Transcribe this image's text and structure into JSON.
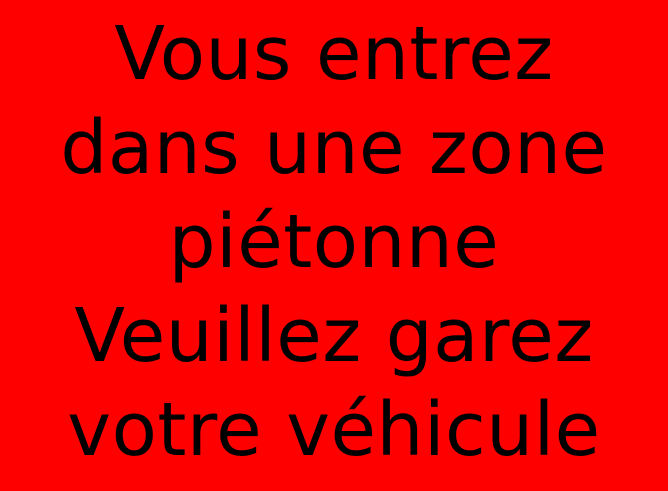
{
  "sign": {
    "background_color": "#FF0000",
    "text_color": "#000000",
    "lines": [
      "Vous entrez",
      "dans une zone",
      "piétonne",
      "Veuillez garez",
      "votre véhicule"
    ]
  }
}
